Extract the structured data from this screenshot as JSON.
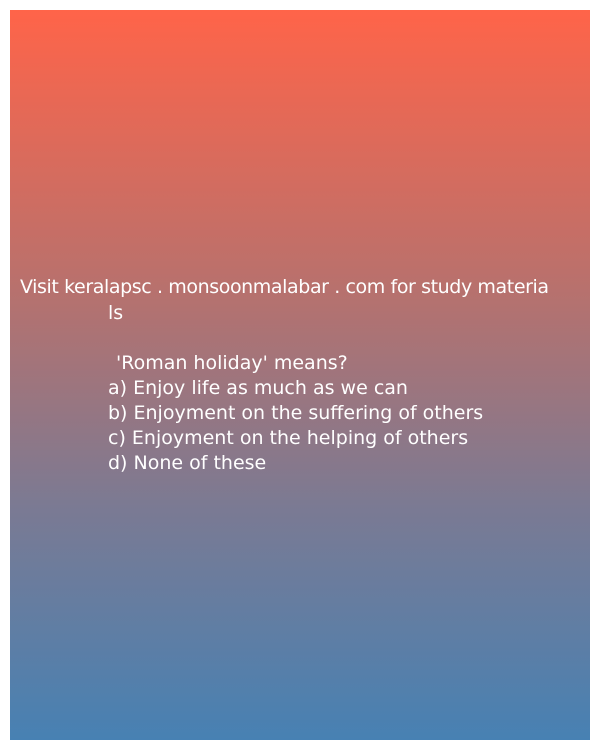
{
  "watermark": {
    "line1": "Visit keralapsc . monsoonmalabar . com for study materia",
    "line2": "ls"
  },
  "question": {
    "text": "'Roman holiday' means?",
    "options": [
      "a) Enjoy life as much as we can",
      "b) Enjoyment on the suffering of others",
      "c) Enjoyment on the helping of others",
      "d) None of these"
    ]
  },
  "colors": {
    "gradient_top": "#ff6449",
    "gradient_bottom": "#4781b3",
    "text": "#ffffff"
  }
}
